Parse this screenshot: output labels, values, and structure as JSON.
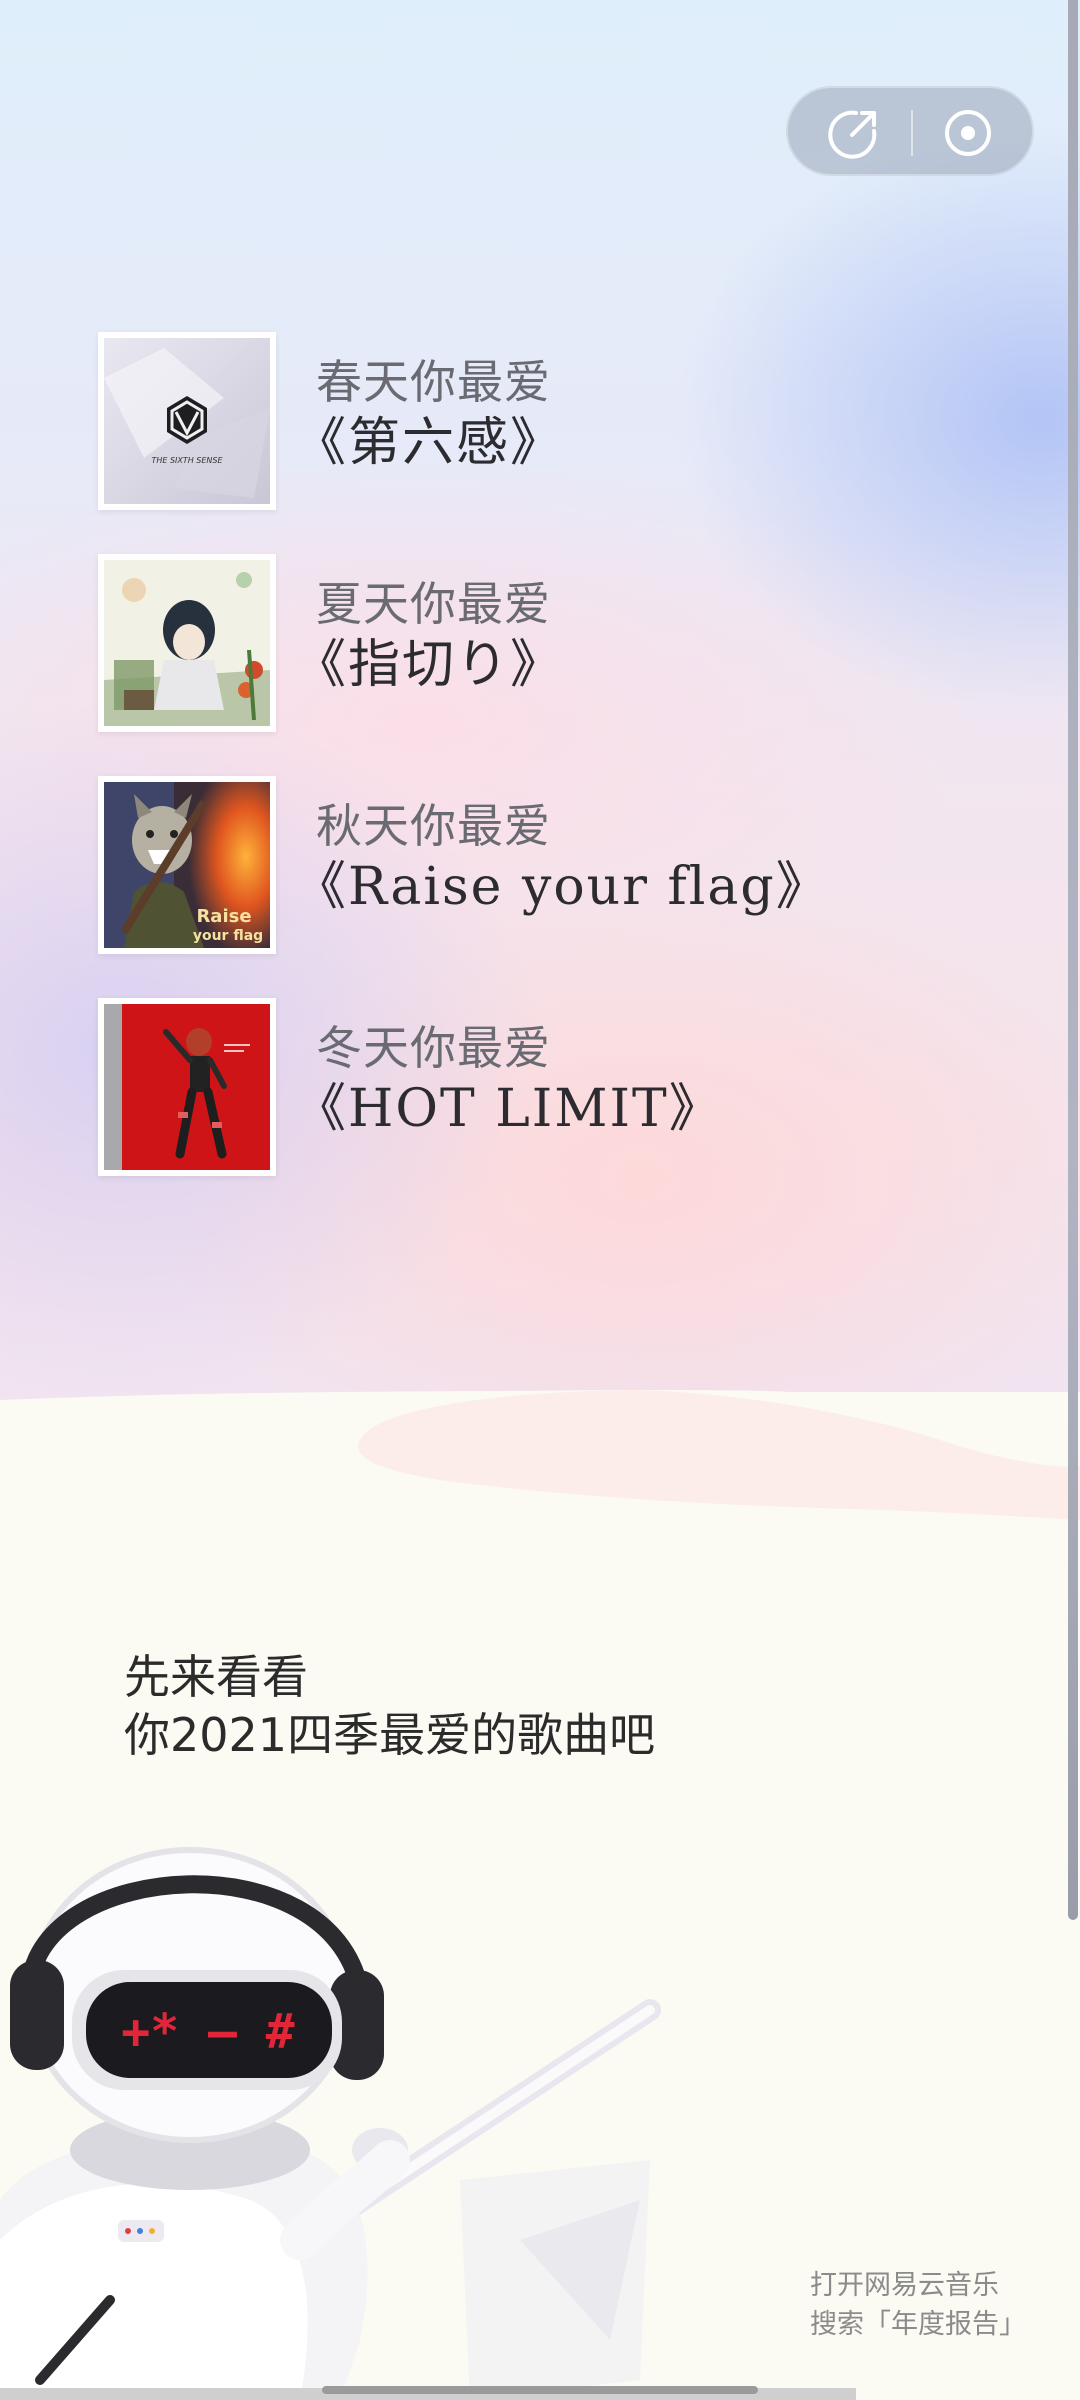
{
  "header": {
    "share_icon": "share-arrow-icon",
    "record_icon": "target-record-icon"
  },
  "seasons": [
    {
      "label": "春天你最爱",
      "title": "《第六感》",
      "cover": "the-sixth-sense-cover"
    },
    {
      "label": "夏天你最爱",
      "title": "《指切り》",
      "cover": "yubikiri-cover"
    },
    {
      "label": "秋天你最爱",
      "title": "《Raise your flag》",
      "cover": "raise-your-flag-cover"
    },
    {
      "label": "冬天你最爱",
      "title": "《HOT LIMIT》",
      "cover": "hot-limit-cover"
    }
  ],
  "intro": {
    "line1": "先来看看",
    "line2": "你2021四季最爱的歌曲吧"
  },
  "footer": {
    "line1": "打开网易云音乐",
    "line2": "搜索「年度报告」"
  },
  "colors": {
    "accent": "#e11a1a",
    "text_primary": "#2c2c30",
    "text_secondary": "#6a6a72"
  }
}
